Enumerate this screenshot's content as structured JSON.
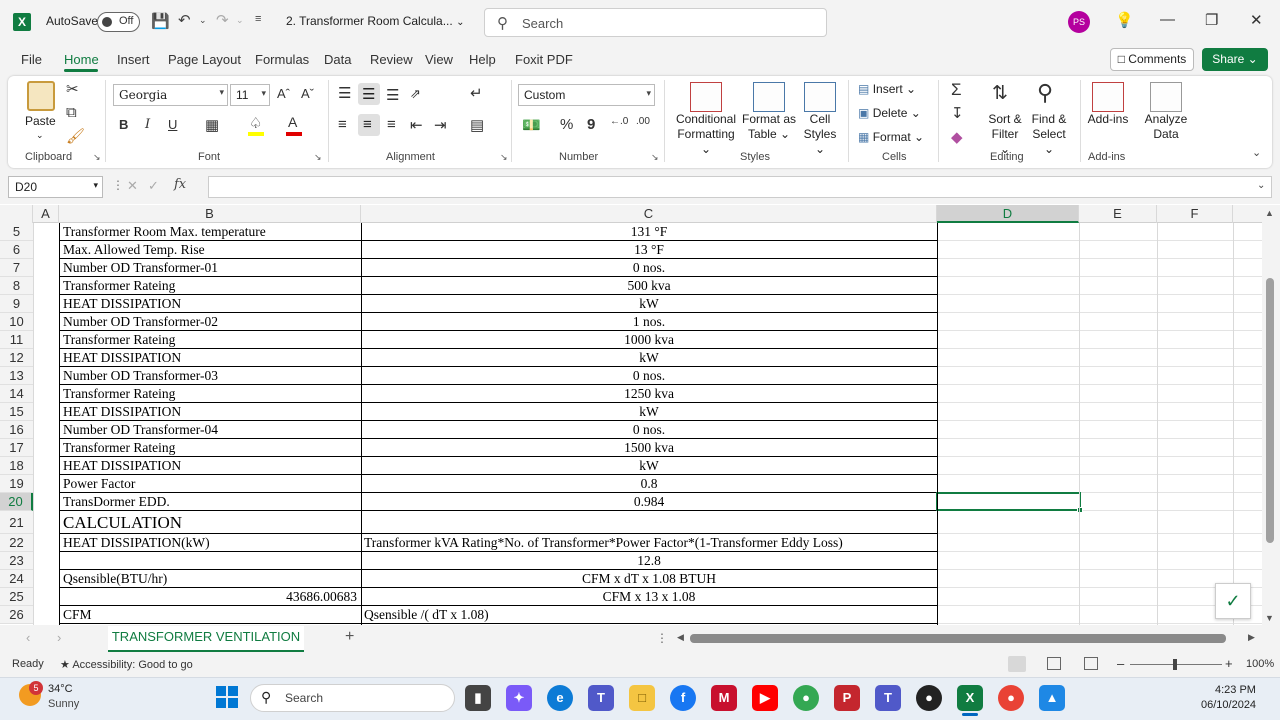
{
  "titlebar": {
    "autosave_label": "AutoSave",
    "autosave_state": "Off",
    "doc_title": "2. Transformer Room Calcula...",
    "search_placeholder": "Search",
    "user_initials": "PS"
  },
  "menu": {
    "items": [
      "File",
      "Home",
      "Insert",
      "Page Layout",
      "Formulas",
      "Data",
      "Review",
      "View",
      "Help",
      "Foxit PDF"
    ],
    "active": "Home",
    "comments_label": "Comments",
    "share_label": "Share"
  },
  "ribbon": {
    "clipboard": {
      "paste": "Paste",
      "label": "Clipboard"
    },
    "font": {
      "name": "Georgia",
      "size": "11",
      "label": "Font",
      "bold": "B",
      "italic": "I",
      "underline": "U"
    },
    "alignment": {
      "label": "Alignment"
    },
    "number": {
      "format": "Custom",
      "label": "Number",
      "percent": "%",
      "comma": "9"
    },
    "styles": {
      "conditional": "Conditional",
      "conditional2": "Formatting",
      "format_as": "Format as",
      "table": "Table",
      "cell": "Cell",
      "cell_styles": "Styles",
      "label": "Styles"
    },
    "cells": {
      "insert": "Insert",
      "delete": "Delete",
      "format": "Format",
      "label": "Cells"
    },
    "editing": {
      "sort": "Sort &",
      "filter": "Filter",
      "find": "Find &",
      "select": "Select",
      "label": "Editing"
    },
    "addins": {
      "addins": "Add-ins",
      "analyze": "Analyze",
      "data": "Data",
      "label": "Add-ins"
    }
  },
  "formula_bar": {
    "name_box": "D20",
    "fx": "fx",
    "value": ""
  },
  "columns": [
    "A",
    "B",
    "C",
    "D",
    "E",
    "F"
  ],
  "rows": [
    {
      "num": "5",
      "b": "Transformer Room Max. temperature",
      "b_align": "left",
      "c": "131 °F"
    },
    {
      "num": "6",
      "b": " Max. Allowed Temp. Rise",
      "b_align": "left",
      "c": "13 °F"
    },
    {
      "num": "7",
      "b": "Number OD Transformer-01",
      "b_align": "left",
      "c": "0 nos."
    },
    {
      "num": "8",
      "b": "Transformer Rateing",
      "b_align": "left",
      "c": "500 kva"
    },
    {
      "num": "9",
      "b": "HEAT DISSIPATION",
      "b_align": "left",
      "c": "kW"
    },
    {
      "num": "10",
      "b": "Number OD Transformer-02",
      "b_align": "left",
      "c": "1 nos."
    },
    {
      "num": "11",
      "b": "Transformer Rateing",
      "b_align": "left",
      "c": "1000 kva"
    },
    {
      "num": "12",
      "b": "HEAT DISSIPATION",
      "b_align": "left",
      "c": "kW"
    },
    {
      "num": "13",
      "b": "Number OD Transformer-03",
      "b_align": "left",
      "c": "0 nos."
    },
    {
      "num": "14",
      "b": "Transformer Rateing",
      "b_align": "left",
      "c": "1250 kva"
    },
    {
      "num": "15",
      "b": "HEAT DISSIPATION",
      "b_align": "left",
      "c": "kW"
    },
    {
      "num": "16",
      "b": "Number OD Transformer-04",
      "b_align": "left",
      "c": "0 nos."
    },
    {
      "num": "17",
      "b": "Transformer Rateing",
      "b_align": "left",
      "c": "1500 kva"
    },
    {
      "num": "18",
      "b": "HEAT DISSIPATION",
      "b_align": "left",
      "c": "kW"
    },
    {
      "num": "19",
      "b": "Power  Factor",
      "b_align": "left",
      "c": "0.8"
    },
    {
      "num": "20",
      "b": "TransDormer EDD.",
      "b_align": "left",
      "c": "0.984"
    },
    {
      "num": "21",
      "b": "CALCULATION",
      "b_align": "left",
      "c": ""
    },
    {
      "num": "22",
      "b": "HEAT DISSIPATION(kW)",
      "b_align": "left",
      "c": "Transformer kVA Rating*No. of Transformer*Power Factor*(1-Transformer Eddy Loss)"
    },
    {
      "num": "23",
      "b": "",
      "b_align": "left",
      "c": "12.8"
    },
    {
      "num": "24",
      "b": "Qsensible(BTU/hr)",
      "b_align": "left",
      "c": "CFM x dT x 1.08 BTUH"
    },
    {
      "num": "25",
      "b": "43686.00683",
      "b_align": "right",
      "c": "CFM x 13 x 1.08"
    },
    {
      "num": "26",
      "b": "CFM",
      "b_align": "left",
      "c": "Qsensible /( dT x 1.08)"
    }
  ],
  "sheet_tab": "TRANSFORMER VENTILATION",
  "status": {
    "ready": "Ready",
    "accessibility": "Accessibility: Good to go",
    "zoom": "100%"
  },
  "taskbar": {
    "weather_temp": "34°C",
    "weather_desc": "Sunny",
    "weather_badge": "5",
    "search": "Search",
    "time": "4:23 PM",
    "date": "06/10/2024"
  }
}
